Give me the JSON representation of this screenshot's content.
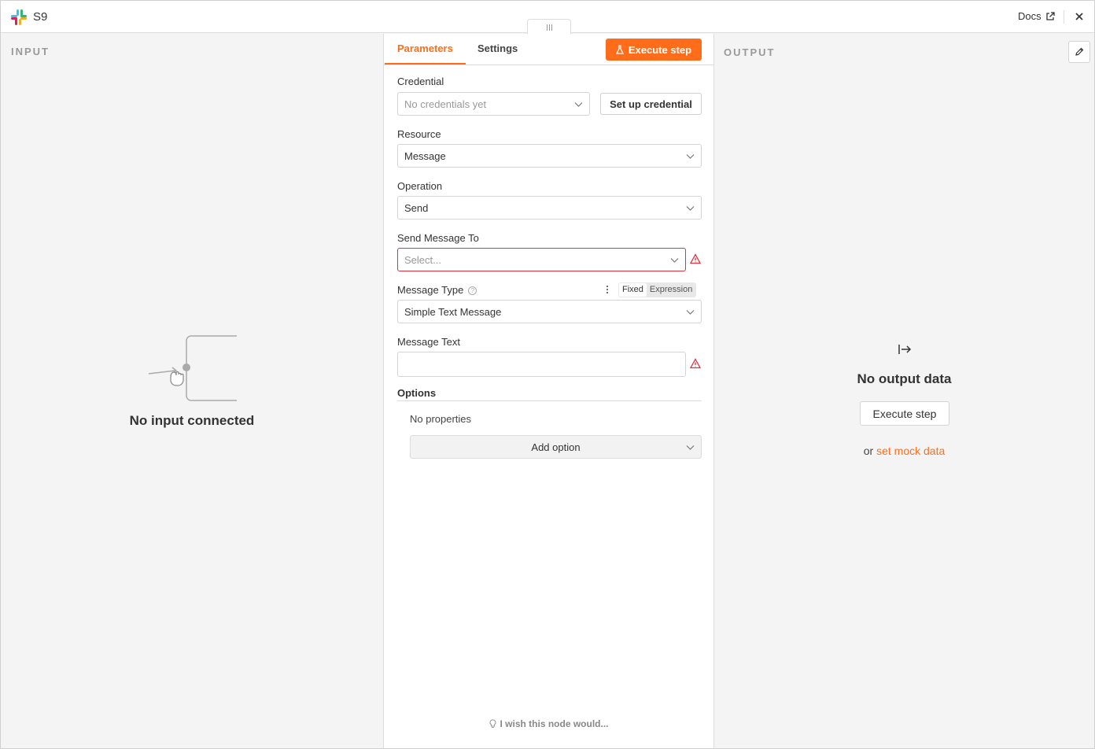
{
  "header": {
    "node_title": "S9",
    "docs_label": "Docs"
  },
  "input_panel": {
    "label": "INPUT",
    "empty_text": "No input connected"
  },
  "params": {
    "tabs": [
      "Parameters",
      "Settings"
    ],
    "execute_label": "Execute step",
    "credential": {
      "label": "Credential",
      "placeholder": "No credentials yet",
      "setup_label": "Set up credential"
    },
    "resource": {
      "label": "Resource",
      "value": "Message"
    },
    "operation": {
      "label": "Operation",
      "value": "Send"
    },
    "send_to": {
      "label": "Send Message To",
      "placeholder": "Select..."
    },
    "message_type": {
      "label": "Message Type",
      "value": "Simple Text Message",
      "mode_fixed": "Fixed",
      "mode_expression": "Expression",
      "active_mode": "Fixed"
    },
    "message_text": {
      "label": "Message Text",
      "value": ""
    },
    "options": {
      "label": "Options",
      "empty_text": "No properties",
      "add_label": "Add option"
    },
    "feedback_label": "I wish this node would..."
  },
  "output_panel": {
    "label": "OUTPUT",
    "empty_title": "No output data",
    "execute_label": "Execute step",
    "or_text": "or",
    "mock_link": "set mock data"
  },
  "colors": {
    "accent": "#ff6d1a",
    "error": "#e0313f"
  }
}
